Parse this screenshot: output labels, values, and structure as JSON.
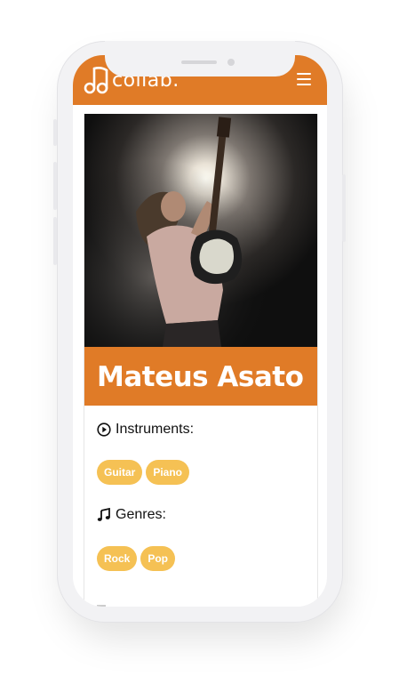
{
  "app": {
    "logo_text": "collab."
  },
  "profile": {
    "name": "Mateus Asato",
    "instruments_label": "Instruments:",
    "instruments": [
      "Guitar",
      "Piano"
    ],
    "genres_label": "Genres:",
    "genres": [
      "Rock",
      "Pop"
    ]
  },
  "colors": {
    "brand": "#e07b27",
    "tag": "#f5c154"
  },
  "icons": {
    "logo": "music-note-logo-icon",
    "menu": "hamburger-menu-icon",
    "instruments": "play-circle-icon",
    "genres": "music-notes-icon"
  }
}
